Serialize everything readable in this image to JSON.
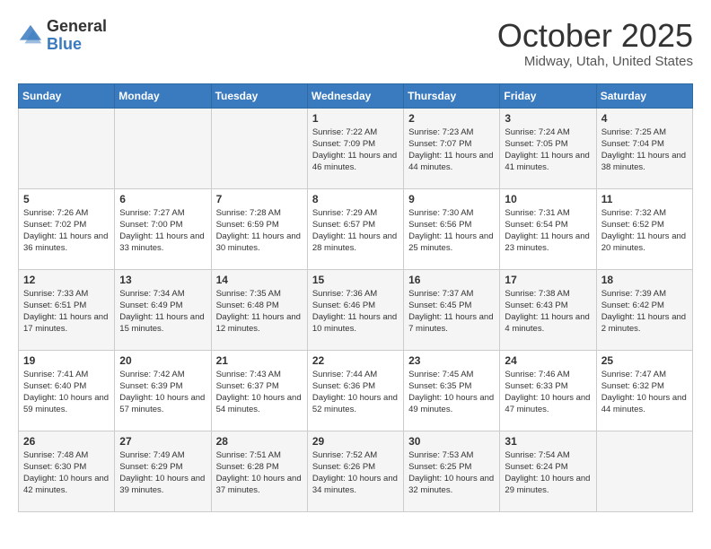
{
  "header": {
    "logo_general": "General",
    "logo_blue": "Blue",
    "month_title": "October 2025",
    "location": "Midway, Utah, United States"
  },
  "weekdays": [
    "Sunday",
    "Monday",
    "Tuesday",
    "Wednesday",
    "Thursday",
    "Friday",
    "Saturday"
  ],
  "weeks": [
    [
      {
        "day": "",
        "info": ""
      },
      {
        "day": "",
        "info": ""
      },
      {
        "day": "",
        "info": ""
      },
      {
        "day": "1",
        "info": "Sunrise: 7:22 AM\nSunset: 7:09 PM\nDaylight: 11 hours and 46 minutes."
      },
      {
        "day": "2",
        "info": "Sunrise: 7:23 AM\nSunset: 7:07 PM\nDaylight: 11 hours and 44 minutes."
      },
      {
        "day": "3",
        "info": "Sunrise: 7:24 AM\nSunset: 7:05 PM\nDaylight: 11 hours and 41 minutes."
      },
      {
        "day": "4",
        "info": "Sunrise: 7:25 AM\nSunset: 7:04 PM\nDaylight: 11 hours and 38 minutes."
      }
    ],
    [
      {
        "day": "5",
        "info": "Sunrise: 7:26 AM\nSunset: 7:02 PM\nDaylight: 11 hours and 36 minutes."
      },
      {
        "day": "6",
        "info": "Sunrise: 7:27 AM\nSunset: 7:00 PM\nDaylight: 11 hours and 33 minutes."
      },
      {
        "day": "7",
        "info": "Sunrise: 7:28 AM\nSunset: 6:59 PM\nDaylight: 11 hours and 30 minutes."
      },
      {
        "day": "8",
        "info": "Sunrise: 7:29 AM\nSunset: 6:57 PM\nDaylight: 11 hours and 28 minutes."
      },
      {
        "day": "9",
        "info": "Sunrise: 7:30 AM\nSunset: 6:56 PM\nDaylight: 11 hours and 25 minutes."
      },
      {
        "day": "10",
        "info": "Sunrise: 7:31 AM\nSunset: 6:54 PM\nDaylight: 11 hours and 23 minutes."
      },
      {
        "day": "11",
        "info": "Sunrise: 7:32 AM\nSunset: 6:52 PM\nDaylight: 11 hours and 20 minutes."
      }
    ],
    [
      {
        "day": "12",
        "info": "Sunrise: 7:33 AM\nSunset: 6:51 PM\nDaylight: 11 hours and 17 minutes."
      },
      {
        "day": "13",
        "info": "Sunrise: 7:34 AM\nSunset: 6:49 PM\nDaylight: 11 hours and 15 minutes."
      },
      {
        "day": "14",
        "info": "Sunrise: 7:35 AM\nSunset: 6:48 PM\nDaylight: 11 hours and 12 minutes."
      },
      {
        "day": "15",
        "info": "Sunrise: 7:36 AM\nSunset: 6:46 PM\nDaylight: 11 hours and 10 minutes."
      },
      {
        "day": "16",
        "info": "Sunrise: 7:37 AM\nSunset: 6:45 PM\nDaylight: 11 hours and 7 minutes."
      },
      {
        "day": "17",
        "info": "Sunrise: 7:38 AM\nSunset: 6:43 PM\nDaylight: 11 hours and 4 minutes."
      },
      {
        "day": "18",
        "info": "Sunrise: 7:39 AM\nSunset: 6:42 PM\nDaylight: 11 hours and 2 minutes."
      }
    ],
    [
      {
        "day": "19",
        "info": "Sunrise: 7:41 AM\nSunset: 6:40 PM\nDaylight: 10 hours and 59 minutes."
      },
      {
        "day": "20",
        "info": "Sunrise: 7:42 AM\nSunset: 6:39 PM\nDaylight: 10 hours and 57 minutes."
      },
      {
        "day": "21",
        "info": "Sunrise: 7:43 AM\nSunset: 6:37 PM\nDaylight: 10 hours and 54 minutes."
      },
      {
        "day": "22",
        "info": "Sunrise: 7:44 AM\nSunset: 6:36 PM\nDaylight: 10 hours and 52 minutes."
      },
      {
        "day": "23",
        "info": "Sunrise: 7:45 AM\nSunset: 6:35 PM\nDaylight: 10 hours and 49 minutes."
      },
      {
        "day": "24",
        "info": "Sunrise: 7:46 AM\nSunset: 6:33 PM\nDaylight: 10 hours and 47 minutes."
      },
      {
        "day": "25",
        "info": "Sunrise: 7:47 AM\nSunset: 6:32 PM\nDaylight: 10 hours and 44 minutes."
      }
    ],
    [
      {
        "day": "26",
        "info": "Sunrise: 7:48 AM\nSunset: 6:30 PM\nDaylight: 10 hours and 42 minutes."
      },
      {
        "day": "27",
        "info": "Sunrise: 7:49 AM\nSunset: 6:29 PM\nDaylight: 10 hours and 39 minutes."
      },
      {
        "day": "28",
        "info": "Sunrise: 7:51 AM\nSunset: 6:28 PM\nDaylight: 10 hours and 37 minutes."
      },
      {
        "day": "29",
        "info": "Sunrise: 7:52 AM\nSunset: 6:26 PM\nDaylight: 10 hours and 34 minutes."
      },
      {
        "day": "30",
        "info": "Sunrise: 7:53 AM\nSunset: 6:25 PM\nDaylight: 10 hours and 32 minutes."
      },
      {
        "day": "31",
        "info": "Sunrise: 7:54 AM\nSunset: 6:24 PM\nDaylight: 10 hours and 29 minutes."
      },
      {
        "day": "",
        "info": ""
      }
    ]
  ]
}
